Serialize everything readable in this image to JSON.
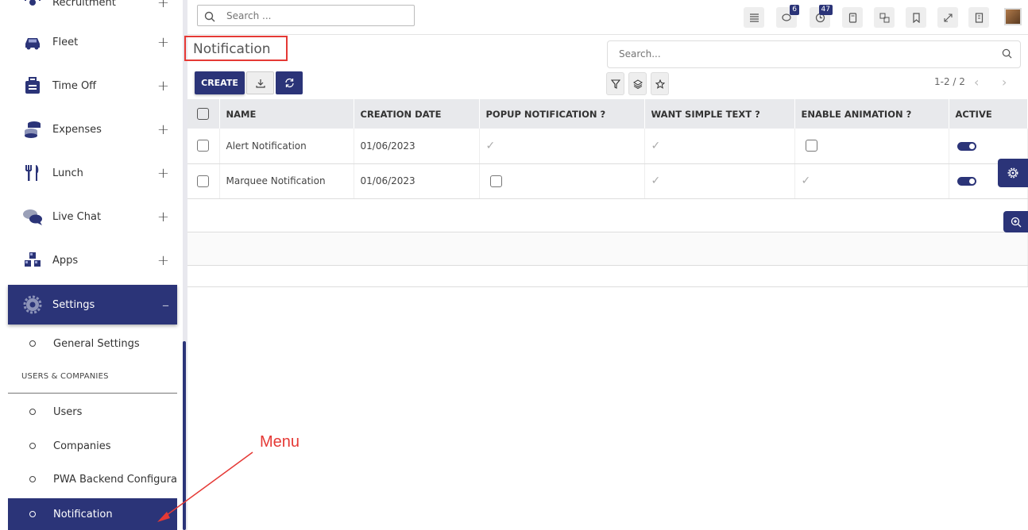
{
  "sidebar": {
    "items": [
      {
        "label": "Recruitment",
        "toggle": "+"
      },
      {
        "label": "Fleet",
        "toggle": "+"
      },
      {
        "label": "Time Off",
        "toggle": "+"
      },
      {
        "label": "Expenses",
        "toggle": "+"
      },
      {
        "label": "Lunch",
        "toggle": "+"
      },
      {
        "label": "Live Chat",
        "toggle": "+"
      },
      {
        "label": "Apps",
        "toggle": "+"
      },
      {
        "label": "Settings",
        "toggle": "–"
      }
    ],
    "sub_general": "General Settings",
    "section_label": "USERS & COMPANIES",
    "sub_items": [
      "Users",
      "Companies",
      "PWA Backend Configurat",
      "Notification"
    ]
  },
  "topbar": {
    "search_placeholder": "Search ...",
    "chat_badge": "6",
    "activity_badge": "47"
  },
  "page": {
    "title": "Notification",
    "search_placeholder": "Search...",
    "create_label": "CREATE",
    "pager": "1-2 / 2",
    "prev": "‹",
    "next": "›"
  },
  "table": {
    "headers": [
      "NAME",
      "CREATION DATE",
      "POPUP NOTIFICATION ?",
      "WANT SIMPLE TEXT ?",
      "ENABLE ANIMATION ?",
      "ACTIVE"
    ],
    "rows": [
      {
        "name": "Alert Notification",
        "date": "01/06/2023"
      },
      {
        "name": "Marquee Notification",
        "date": "01/06/2023"
      }
    ]
  },
  "annotation": {
    "label": "Menu"
  },
  "colors": {
    "accent": "#2b3478",
    "annotation": "#e53935"
  }
}
